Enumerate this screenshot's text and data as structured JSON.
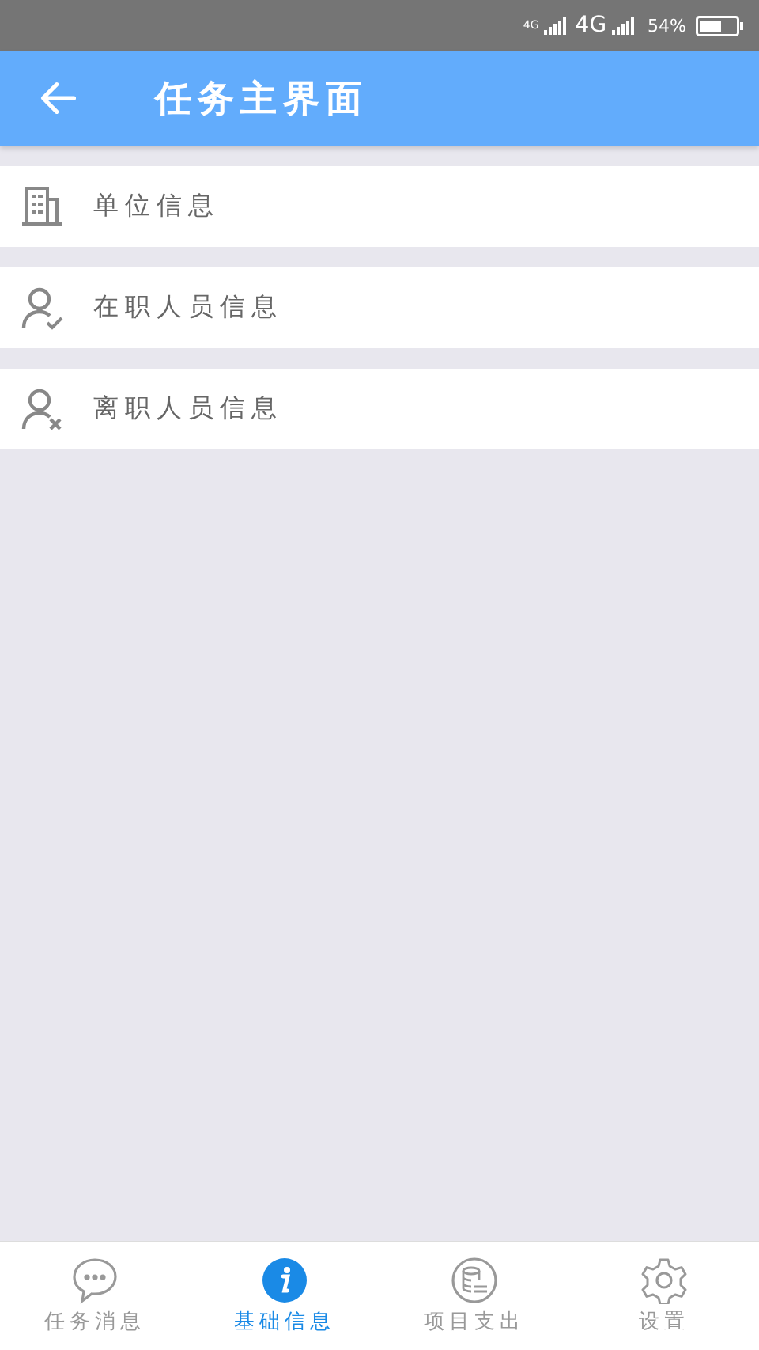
{
  "status_bar": {
    "network_small": "4G",
    "network": "4G",
    "battery": "54%"
  },
  "header": {
    "title": "任务主界面"
  },
  "menu": [
    {
      "label": "单位信息"
    },
    {
      "label": "在职人员信息"
    },
    {
      "label": "离职人员信息"
    }
  ],
  "bottom_nav": [
    {
      "label": "任务消息",
      "selected": false
    },
    {
      "label": "基础信息",
      "selected": true
    },
    {
      "label": "项目支出",
      "selected": false
    },
    {
      "label": "设置",
      "selected": false
    }
  ]
}
